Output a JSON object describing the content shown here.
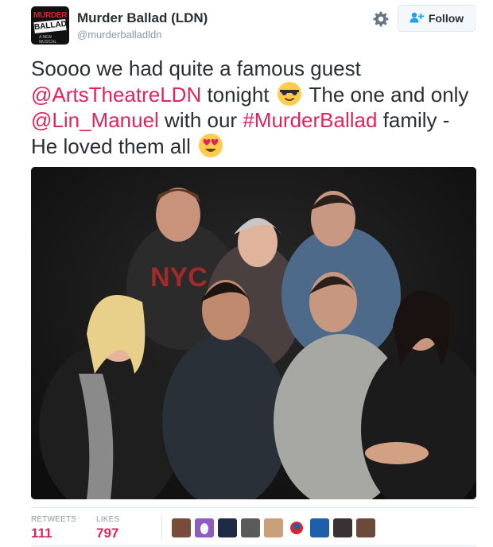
{
  "account": {
    "name": "Murder Ballad (LDN)",
    "handle": "@murderballadldn",
    "avatar_text": [
      "MURDER",
      "BALLAD",
      "A NEW MUSICAL"
    ]
  },
  "actions": {
    "follow_label": "Follow",
    "gear_icon": "gear-icon",
    "follow_icon": "person-add-icon"
  },
  "tweet": {
    "part1": "Soooo we had quite a famous guest ",
    "mention1": "@ArtsTheatreLDN",
    "part2": " tonight ",
    "emoji1": "sunglasses-face-emoji",
    "part3": " The one and only ",
    "mention2": "@Lin_Manuel",
    "part4": " with our ",
    "hashtag": "#MurderBallad",
    "part5": " family - He loved them all ",
    "emoji2": "heart-eyes-face-emoji"
  },
  "stats": {
    "retweets_label": "RETWEETS",
    "retweets_value": "111",
    "likes_label": "LIKES",
    "likes_value": "797"
  },
  "colors": {
    "link": "#e0245e",
    "text": "#292f33",
    "muted": "#8899a6",
    "border": "#e1e8ed"
  },
  "likers": [
    "liker-avatar-1",
    "liker-avatar-2",
    "liker-avatar-3",
    "liker-avatar-4",
    "liker-avatar-5",
    "liker-avatar-6",
    "liker-avatar-7",
    "liker-avatar-8",
    "liker-avatar-9"
  ]
}
